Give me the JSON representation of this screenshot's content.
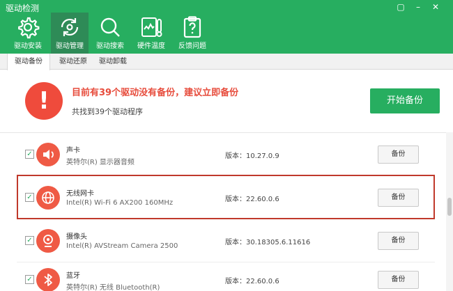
{
  "window": {
    "title": "驱动检测",
    "controls": [
      "▢",
      "–",
      "✕"
    ]
  },
  "toolbar": {
    "items": [
      {
        "label": "驱动安装",
        "icon": "gear-icon"
      },
      {
        "label": "驱动管理",
        "icon": "refresh-icon",
        "active": true
      },
      {
        "label": "驱动搜索",
        "icon": "search-icon"
      },
      {
        "label": "硬件温度",
        "icon": "temperature-icon"
      },
      {
        "label": "反馈问题",
        "icon": "clipboard-question-icon"
      }
    ]
  },
  "tabs": [
    {
      "label": "驱动备份",
      "active": true
    },
    {
      "label": "驱动还原"
    },
    {
      "label": "驱动卸载"
    }
  ],
  "banner": {
    "title": "目前有39个驱动没有备份，建议立即备份",
    "subtitle": "共找到39个驱动程序",
    "button": "开始备份",
    "icon_glyph": "!"
  },
  "drivers": [
    {
      "name": "声卡",
      "device": "英特尔(R) 显示器音频",
      "version": "版本：10.27.0.9",
      "button": "备份",
      "icon": "speaker-icon",
      "checked": true
    },
    {
      "name": "无线网卡",
      "device": "Intel(R) Wi-Fi 6 AX200 160MHz",
      "version": "版本：22.60.0.6",
      "button": "备份",
      "icon": "globe-icon",
      "checked": true,
      "highlighted": true
    },
    {
      "name": "摄像头",
      "device": "Intel(R) AVStream Camera 2500",
      "version": "版本：30.18305.6.11616",
      "button": "备份",
      "icon": "camera-icon",
      "checked": true
    },
    {
      "name": "蓝牙",
      "device": "英特尔(R) 无线 Bluetooth(R)",
      "version": "版本：22.60.0.6",
      "button": "备份",
      "icon": "bluetooth-icon",
      "checked": true
    }
  ],
  "colors": {
    "brand_green": "#27ae60",
    "alert_red": "#ef4b3c",
    "highlight_border": "#c0392b"
  }
}
